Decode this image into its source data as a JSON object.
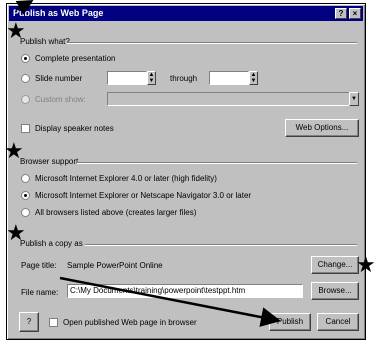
{
  "window": {
    "title": "Publish as Web Page",
    "help_label": "?",
    "close_label": "×"
  },
  "publish_what": {
    "heading": "Publish what?",
    "complete_presentation": "Complete presentation",
    "slide_number": "Slide number",
    "through": "through",
    "custom_show": "Custom show:",
    "custom_show_value": "",
    "display_speaker_notes": "Display speaker notes",
    "web_options": "Web Options...",
    "spin_up": "▲",
    "spin_down": "▼",
    "dropdown_arrow": "▼"
  },
  "browser_support": {
    "heading": "Browser support",
    "option1": "Microsoft Internet Explorer 4.0 or later (high fidelity)",
    "option2": "Microsoft Internet Explorer or Netscape Navigator 3.0 or later",
    "option3": "All browsers listed above (creates larger files)",
    "selected_option": "option2"
  },
  "publish_copy": {
    "heading": "Publish a copy as",
    "page_title_label": "Page title:",
    "page_title_value": "Sample PowerPoint Online",
    "change": "Change...",
    "file_name_label": "File name:",
    "file_name_value": "C:\\My Documents\\training\\powerpoint\\testppt.htm",
    "browse": "Browse...",
    "open_in_browser": "Open published Web page in browser",
    "publish": "Publish",
    "cancel": "Cancel"
  },
  "annotation": {
    "star_glyph": "★"
  }
}
